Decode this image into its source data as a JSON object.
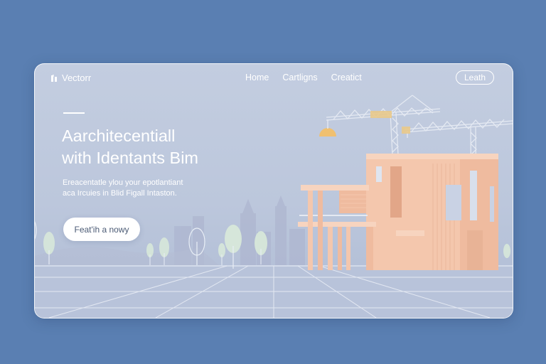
{
  "brand": {
    "name": "Vectorr",
    "icon": "logo-mark-icon"
  },
  "nav": {
    "links": [
      "Home",
      "Cartligns",
      "Creatict"
    ],
    "button_label": "Leath"
  },
  "hero": {
    "headline_line1": "Aarchitecentiall",
    "headline_line2": "with Identants Bim",
    "subtext_line1": "Ereacentatle ylou your epotlantiant",
    "subtext_line2": "aca Ircuies in Blid Figall Intaston.",
    "cta_label": "Feat'ih a nowy"
  },
  "colors": {
    "background": "#5a7fb2",
    "card_sky": "#c3cde0",
    "building_peach": "#f4c7ad",
    "crane": "#e4e9f2",
    "lamp": "#f0c070",
    "trees": "#d9ead9"
  }
}
